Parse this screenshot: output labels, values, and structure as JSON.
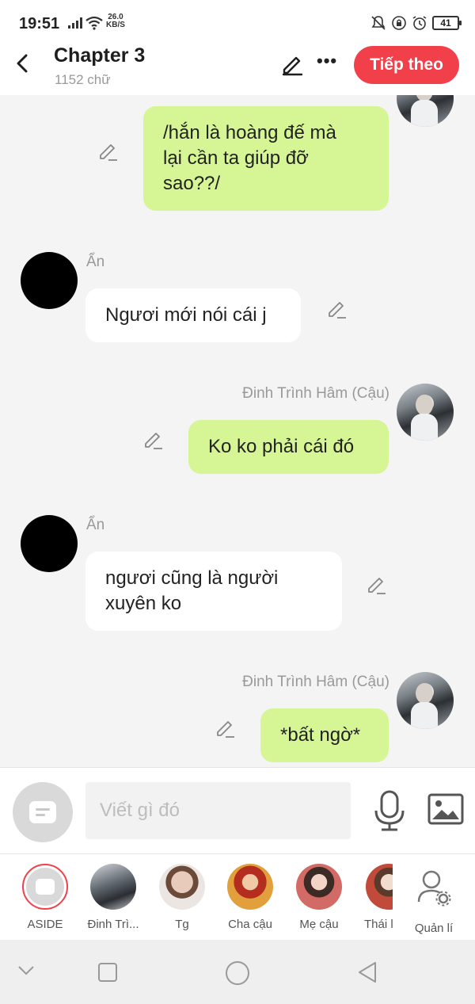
{
  "status_bar": {
    "time": "19:51",
    "network_speed_value": "26.0",
    "network_speed_unit": "KB/S",
    "battery": "41"
  },
  "header": {
    "title": "Chapter 3",
    "word_count": "1152 chữ",
    "next_button": "Tiếp theo"
  },
  "messages": [
    {
      "side": "right",
      "sender": "",
      "text_lines": [
        "/hắn là hoàng đế mà",
        "lại cần ta giúp đỡ",
        "sao??/"
      ]
    },
    {
      "side": "left",
      "sender": "Ẩn",
      "text_lines": [
        "Ngươi mới nói cái j"
      ]
    },
    {
      "side": "right",
      "sender": "Đinh Trình Hâm (Cậu)",
      "text_lines": [
        "Ko ko phải cái đó"
      ]
    },
    {
      "side": "left",
      "sender": "Ẩn",
      "text_lines": [
        "ngươi cũng là người",
        "xuyên ko"
      ]
    },
    {
      "side": "right",
      "sender": "Đinh Trình Hâm (Cậu)",
      "text_lines": [
        "*bất ngờ*"
      ]
    }
  ],
  "composer": {
    "placeholder": "Viết gì đó"
  },
  "characters": [
    {
      "label": "ASIDE",
      "selected": true
    },
    {
      "label": "Đinh Trì..."
    },
    {
      "label": "Tg"
    },
    {
      "label": "Cha cậu"
    },
    {
      "label": "Mẹ cậu"
    },
    {
      "label": "Thái l"
    },
    {
      "label": "Quản lí"
    }
  ],
  "colors": {
    "accent": "#f2404b",
    "bubble_self": "#d6f595",
    "bubble_other": "#ffffff",
    "background": "#f4f4f4"
  }
}
